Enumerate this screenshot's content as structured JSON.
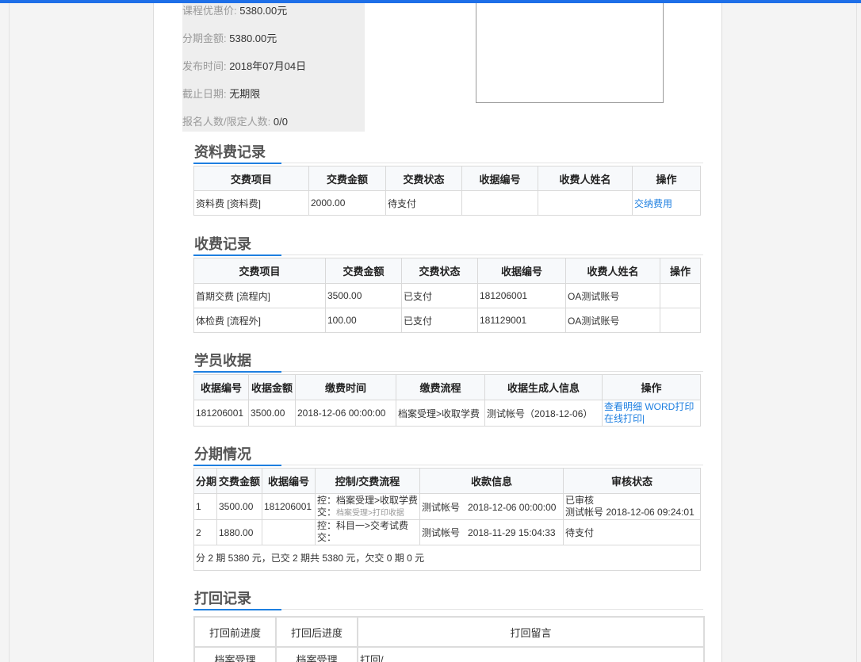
{
  "course_info": {
    "discount_price": {
      "label": "课程优惠价:",
      "value": "5380.00元"
    },
    "installment_amount": {
      "label": "分期金额:",
      "value": "5380.00元"
    },
    "publish_time": {
      "label": "发布时间:",
      "value": "2018年07月04日"
    },
    "deadline": {
      "label": "截止日期:",
      "value": "无期限"
    },
    "enrollment": {
      "label": "报名人数/限定人数:",
      "value": "0/0"
    }
  },
  "material_fee": {
    "title": "资料费记录",
    "headers": [
      "交费项目",
      "交费金额",
      "交费状态",
      "收据编号",
      "收费人姓名",
      "操作"
    ],
    "rows": [
      {
        "item": "资料费 [资料费]",
        "amount": "2000.00",
        "status": "待支付",
        "receipt": "",
        "collector": "",
        "action": "交纳费用"
      }
    ]
  },
  "fee_record": {
    "title": "收费记录",
    "headers": [
      "交费项目",
      "交费金额",
      "交费状态",
      "收据编号",
      "收费人姓名",
      "操作"
    ],
    "rows": [
      {
        "item": "首期交费 [流程内]",
        "amount": "3500.00",
        "status": "已支付",
        "receipt": "181206001",
        "collector": "OA测试账号",
        "action": ""
      },
      {
        "item": "体检费 [流程外]",
        "amount": "100.00",
        "status": "已支付",
        "receipt": "181129001",
        "collector": "OA测试账号",
        "action": ""
      }
    ]
  },
  "student_receipt": {
    "title": "学员收据",
    "headers": [
      "收据编号",
      "收据金额",
      "缴费时间",
      "缴费流程",
      "收据生成人信息",
      "操作"
    ],
    "rows": [
      {
        "receipt": "181206001",
        "amount": "3500.00",
        "time": "2018-12-06 00:00:00",
        "flow": "档案受理>收取学费",
        "creator": "测试帐号（2018-12-06）",
        "view_detail": "查看明细",
        "word_print": "WORD打印",
        "online_print": "在线打印|"
      }
    ]
  },
  "installments": {
    "title": "分期情况",
    "headers": [
      "分期",
      "交费金额",
      "收据编号",
      "控制/交费流程",
      "收款信息",
      "审核状态"
    ],
    "rows": [
      {
        "period": "1",
        "amount": "3500.00",
        "receipt": "181206001",
        "control": "控：档案受理>收取学费",
        "pay": "交：",
        "pay_detail": "档案受理>打印收据",
        "payee": "测试帐号",
        "pay_time": "2018-12-06 00:00:00",
        "audit_status": "已审核",
        "audit_detail": "测试帐号 2018-12-06 09:24:01"
      },
      {
        "period": "2",
        "amount": "1880.00",
        "receipt": "",
        "control": "控：科目一>交考试费",
        "pay": "交：",
        "pay_detail": "",
        "payee": "测试帐号",
        "pay_time": "2018-11-29 15:04:33",
        "audit_status": "待支付",
        "audit_detail": ""
      }
    ],
    "summary": "分 2 期 5380 元，已交 2 期共 5380 元，欠交 0 期 0 元"
  },
  "return_record": {
    "title": "打回记录",
    "headers": [
      "打回前进度",
      "打回后进度",
      "打回留言"
    ],
    "rows": [
      {
        "before": "档案受理",
        "after": "档案受理",
        "message": "打回/"
      }
    ]
  },
  "colors": {
    "accent": "#1e7fe0",
    "topbar": "#1e6fe8",
    "link": "#1e7fe0"
  }
}
